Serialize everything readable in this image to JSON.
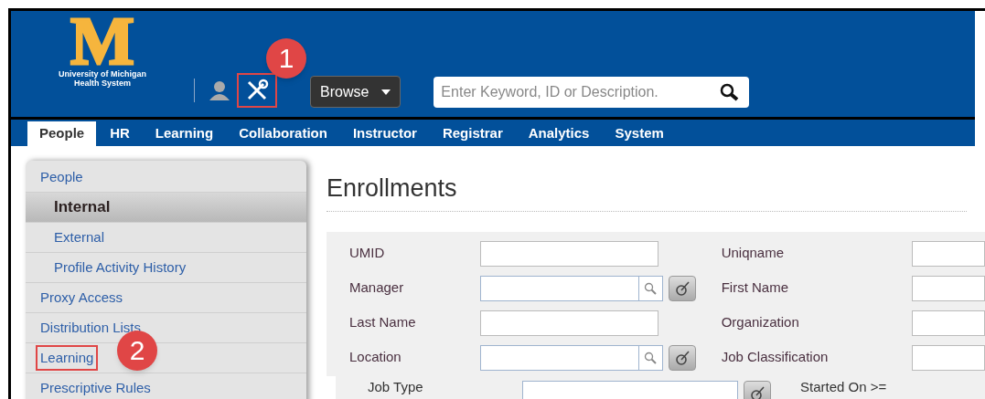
{
  "header": {
    "logo_letter": "M",
    "logo_lines": [
      "University of Michigan",
      "Health System"
    ],
    "tools_callout": "1",
    "browse": {
      "label": "Browse"
    },
    "search": {
      "placeholder": "Enter Keyword, ID or Description."
    }
  },
  "nav_tabs": [
    {
      "label": "People",
      "selected": true
    },
    {
      "label": "HR",
      "selected": false
    },
    {
      "label": "Learning",
      "selected": false
    },
    {
      "label": "Collaboration",
      "selected": false
    },
    {
      "label": "Instructor",
      "selected": false
    },
    {
      "label": "Registrar",
      "selected": false
    },
    {
      "label": "Analytics",
      "selected": false
    },
    {
      "label": "System",
      "selected": false
    }
  ],
  "sidebar": {
    "items": [
      {
        "label": "People",
        "selected": false,
        "children": [
          {
            "label": "Internal",
            "selected": true
          },
          {
            "label": "External",
            "selected": false
          },
          {
            "label": "Profile Activity History",
            "selected": false
          }
        ]
      },
      {
        "label": "Proxy Access",
        "selected": false
      },
      {
        "label": "Distribution Lists",
        "selected": false
      },
      {
        "label": "Learning",
        "selected": false,
        "callout": "2"
      },
      {
        "label": "Prescriptive Rules",
        "selected": false
      }
    ]
  },
  "page_title": "Enrollments",
  "form": {
    "rows": [
      {
        "left": {
          "label": "UMID",
          "kind": "text"
        },
        "right": {
          "label": "Uniqname",
          "kind": "text"
        }
      },
      {
        "left": {
          "label": "Manager",
          "kind": "lookup"
        },
        "right": {
          "label": "First Name",
          "kind": "text"
        }
      },
      {
        "left": {
          "label": "Last Name",
          "kind": "text"
        },
        "right": {
          "label": "Organization",
          "kind": "text"
        }
      },
      {
        "left": {
          "label": "Location",
          "kind": "lookup"
        },
        "right": {
          "label": "Job Classification",
          "kind": "text"
        }
      }
    ],
    "extra_row": {
      "left": {
        "label": "Job Type",
        "kind": "picker"
      },
      "right": {
        "label": "Started On >="
      }
    }
  }
}
